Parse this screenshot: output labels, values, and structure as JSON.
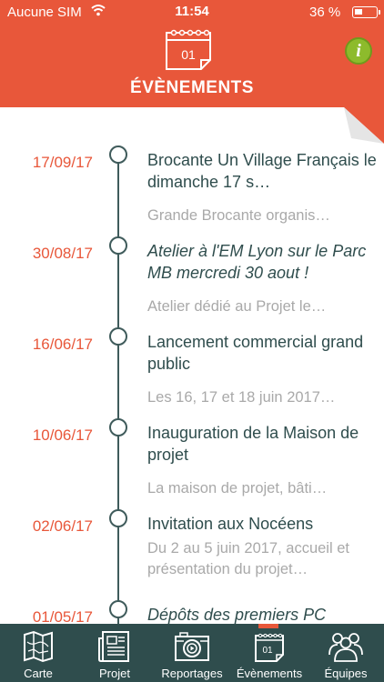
{
  "status_bar": {
    "carrier": "Aucune SIM",
    "time": "11:54",
    "battery": "36 %",
    "battery_level": 0.36
  },
  "header": {
    "title": "ÉVÈNEMENTS",
    "calendar_day": "01",
    "info_label": "i"
  },
  "colors": {
    "accent": "#e8573a",
    "dark": "#2f4d4d",
    "info": "#8dbb2c",
    "muted": "#a9a9a9"
  },
  "events": [
    {
      "date": "17/09/17",
      "title": "Brocante Un Village Français le dimanche 17 s…",
      "description": "Grande Brocante organis…"
    },
    {
      "date": "30/08/17",
      "title": "Atelier à l'EM Lyon sur le Parc MB mercredi 30 aout !",
      "description": "Atelier dédié au Projet le…"
    },
    {
      "date": "16/06/17",
      "title": "Lancement commercial grand public",
      "description": "Les 16, 17 et 18 juin 2017…"
    },
    {
      "date": "10/06/17",
      "title": "Inauguration de la Maison de projet",
      "description": "La maison de projet, bâti…"
    },
    {
      "date": "02/06/17",
      "title": "Invitation aux Nocéens",
      "description": "Du 2 au 5 juin 2017, accueil et présentation du projet…"
    },
    {
      "date": "01/05/17",
      "title": "Dépôts des premiers PC",
      "description": ""
    }
  ],
  "tabs": [
    {
      "label": "Carte",
      "icon": "map-icon"
    },
    {
      "label": "Projet",
      "icon": "newspaper-icon"
    },
    {
      "label": "Reportages",
      "icon": "camera-icon"
    },
    {
      "label": "Évènements",
      "icon": "calendar-icon",
      "active": true
    },
    {
      "label": "Équipes",
      "icon": "people-icon"
    }
  ]
}
